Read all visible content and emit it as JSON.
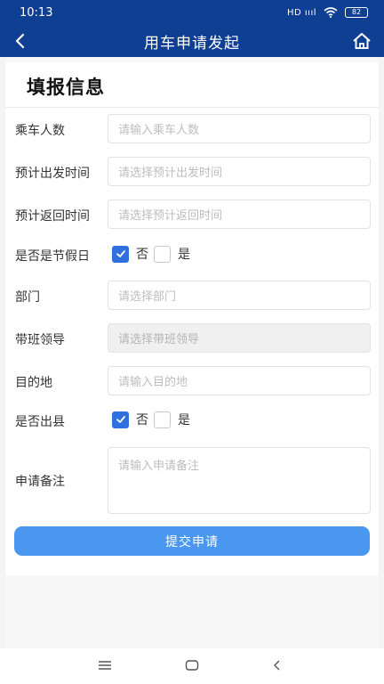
{
  "status_bar": {
    "time": "10:13",
    "signal": "HD ıııl",
    "battery": "82"
  },
  "nav": {
    "title": "用车申请发起",
    "back_icon": "chevron-left-icon",
    "home_icon": "home-icon"
  },
  "form": {
    "section_title": "填报信息",
    "fields": {
      "passengers": {
        "label": "乘车人数",
        "placeholder": "请输入乘车人数"
      },
      "departure_time": {
        "label": "预计出发时间",
        "placeholder": "请选择预计出发时间"
      },
      "return_time": {
        "label": "预计返回时间",
        "placeholder": "请选择预计返回时间"
      },
      "holiday": {
        "label": "是否是节假日",
        "options": [
          "否",
          "是"
        ],
        "selected": "否"
      },
      "department": {
        "label": "部门",
        "placeholder": "请选择部门"
      },
      "leader": {
        "label": "带班领导",
        "placeholder": "请选择带班领导",
        "disabled": true
      },
      "destination": {
        "label": "目的地",
        "placeholder": "请输入目的地"
      },
      "out_of_county": {
        "label": "是否出县",
        "options": [
          "否",
          "是"
        ],
        "selected": "否"
      },
      "remarks": {
        "label": "申请备注",
        "placeholder": "请输入申请备注"
      }
    },
    "submit_label": "提交申请"
  },
  "colors": {
    "header": "#0f3f92",
    "accent": "#2f6fde",
    "button": "#4a97f0"
  }
}
